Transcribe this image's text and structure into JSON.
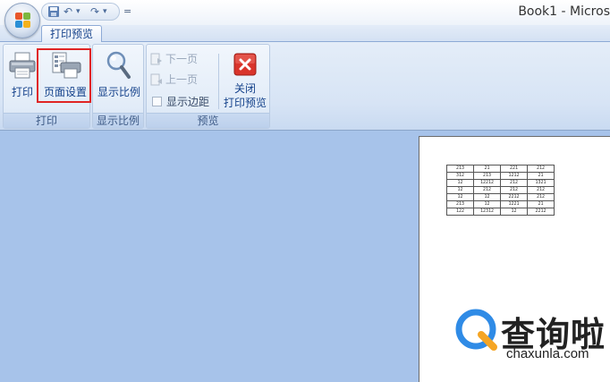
{
  "window": {
    "title": "Book1 - Micros"
  },
  "quick_access": {
    "undo_glyph": "↶",
    "redo_glyph": "↷",
    "dropdown_glyph": "▾",
    "customize_glyph": "="
  },
  "tabs": [
    {
      "label": "打印预览",
      "active": true
    }
  ],
  "ribbon": {
    "groups": {
      "print": {
        "label": "打印",
        "print_button": "打印",
        "page_setup_button": "页面设置"
      },
      "zoom": {
        "label": "显示比例",
        "zoom_button": "显示比例"
      },
      "preview": {
        "label": "预览",
        "next_page": "下一页",
        "prev_page": "上一页",
        "show_margins": "显示边距",
        "close_line1": "关闭",
        "close_line2": "打印预览"
      }
    }
  },
  "colors": {
    "accent": "#15428b",
    "highlight": "#e02424",
    "close_red": "#d9342b",
    "workspace": "#a7c3ea"
  },
  "sheet": {
    "rows": [
      [
        "213",
        "21",
        "221",
        "212"
      ],
      [
        "312",
        "213",
        "1212",
        "21"
      ],
      [
        "12",
        "12212",
        "212",
        "1321"
      ],
      [
        "12",
        "212",
        "212",
        "212"
      ],
      [
        "12",
        "12",
        "2212",
        "212"
      ],
      [
        "213",
        "12",
        "1221",
        "21"
      ],
      [
        "122",
        "12312",
        "12",
        "2212"
      ]
    ]
  },
  "watermark": {
    "title": "查询啦",
    "url": "chaxunla.com"
  }
}
